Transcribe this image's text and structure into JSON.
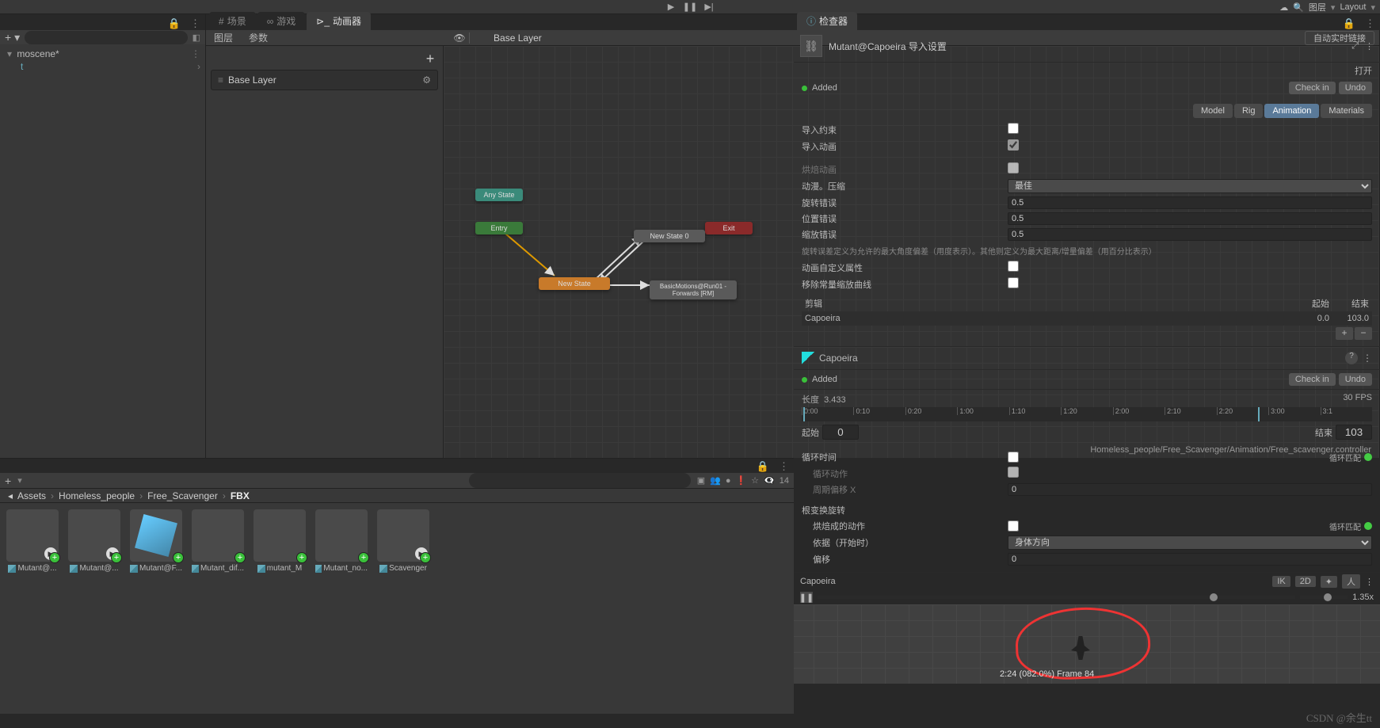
{
  "toolbar": {
    "layers_label": "图层",
    "layout_label": "Layout"
  },
  "tabs": {
    "scene": "场景",
    "game": "游戏",
    "animator": "动画器",
    "inspector": "检查器"
  },
  "hierarchy": {
    "scene": "moscene*",
    "child": "t"
  },
  "animator": {
    "seg_layers": "图层",
    "seg_params": "参数",
    "crumb": "Base Layer",
    "autolive": "自动实时链接",
    "base_layer": "Base Layer",
    "nodes": {
      "anystate": "Any State",
      "entry": "Entry",
      "exit": "Exit",
      "newstate": "New State",
      "newstate0": "New State 0",
      "motion": "BasicMotions@Run01 - Forwards [RM]"
    },
    "path": "Homeless_people/Free_Scavenger/Animation/Free_scavenger.controller"
  },
  "project": {
    "header_plus": "+",
    "search_placeholder": "",
    "count": "14",
    "crumbs": [
      "Assets",
      "Homeless_people",
      "Free_Scavenger",
      "FBX"
    ],
    "assets": [
      {
        "name": "Mutant@..."
      },
      {
        "name": "Mutant@..."
      },
      {
        "name": "Mutant@F..."
      },
      {
        "name": "Mutant_dif..."
      },
      {
        "name": "mutant_M"
      },
      {
        "name": "Mutant_no..."
      },
      {
        "name": "Scavenger"
      }
    ]
  },
  "inspector": {
    "title": "Mutant@Capoeira 导入设置",
    "open": "打开",
    "added": "Added",
    "checkin": "Check in",
    "undo": "Undo",
    "tabs": {
      "model": "Model",
      "rig": "Rig",
      "animation": "Animation",
      "materials": "Materials"
    },
    "props": {
      "import_constraints": "导入约束",
      "import_animation": "导入动画",
      "bake": "烘焙动画",
      "compress": "动漫。压缩",
      "compress_val": "最佳",
      "rot_err": "旋转错误",
      "rot_err_val": "0.5",
      "pos_err": "位置错误",
      "pos_err_val": "0.5",
      "scl_err": "缩放错误",
      "scl_err_val": "0.5",
      "help": "旋转误差定义为允许的最大角度偏差（用度表示）。其他则定义为最大距离/增量偏差（用百分比表示）",
      "custom_props": "动画自定义属性",
      "remove_curves": "移除常量缩放曲线",
      "clips": "剪辑",
      "start": "起始",
      "end": "结束",
      "clip_name": "Capoeira",
      "clip_start": "0.0",
      "clip_end": "103.0",
      "clip_title": "Capoeira",
      "length_lbl": "长度",
      "length": "3.433",
      "fps": "30 FPS",
      "start2": "起始",
      "start2_val": "0",
      "end2": "结束",
      "end2_val": "103",
      "loop_time": "循环时间",
      "loop_pose": "循环动作",
      "cycle_offset": "周期偏移 X",
      "cycle_offset_val": "0",
      "loop_match": "循环匹配",
      "root_rot": "根变换旋转",
      "bake_into": "烘焙成的动作",
      "based": "依据（开始时）",
      "based_val": "身体方向",
      "offset": "偏移",
      "offset_val": "0"
    },
    "timeline_ticks": [
      "0:00",
      "0:10",
      "0:20",
      "1:00",
      "1:10",
      "1:20",
      "2:00",
      "2:10",
      "2:20",
      "3:00",
      "3:1"
    ],
    "preview": {
      "title": "Capoeira",
      "ik": "IK",
      "twod": "2D",
      "speed": "1.35x",
      "status": "2:24 (082.0%) Frame 84"
    }
  },
  "watermark": "CSDN @余生tt"
}
